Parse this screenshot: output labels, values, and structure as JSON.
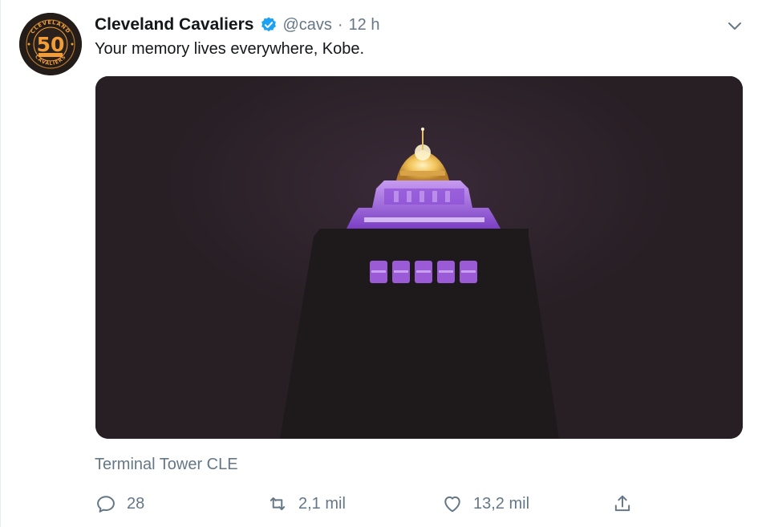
{
  "author": {
    "display_name": "Cleveland Cavaliers",
    "handle": "@cavs",
    "separator": "·",
    "time": "12 h",
    "verified": true,
    "avatar_icon": "cavaliers-50-logo",
    "avatar_number": "50",
    "avatar_ring_text_top": "CLEVELAND",
    "avatar_ring_text_bottom": "CAVALIERS"
  },
  "tweet": {
    "text": "Your memory lives everywhere, Kobe."
  },
  "media": {
    "icon": "terminal-tower-photo",
    "sky_color": "#2a2126",
    "tower_color": "#1e1a1c",
    "light_color": "#9b5bd6",
    "gold_color": "#f2c45a"
  },
  "location": "Terminal Tower CLE",
  "actions": {
    "reply": {
      "icon": "reply-icon",
      "count": "28"
    },
    "retweet": {
      "icon": "retweet-icon",
      "count": "2,1 mil"
    },
    "like": {
      "icon": "heart-icon",
      "count": "13,2 mil"
    },
    "share": {
      "icon": "share-icon"
    }
  },
  "colors": {
    "text_primary": "#14171a",
    "text_secondary": "#657786",
    "verified_blue": "#1da1f2",
    "avatar_gold": "#f29d38"
  }
}
